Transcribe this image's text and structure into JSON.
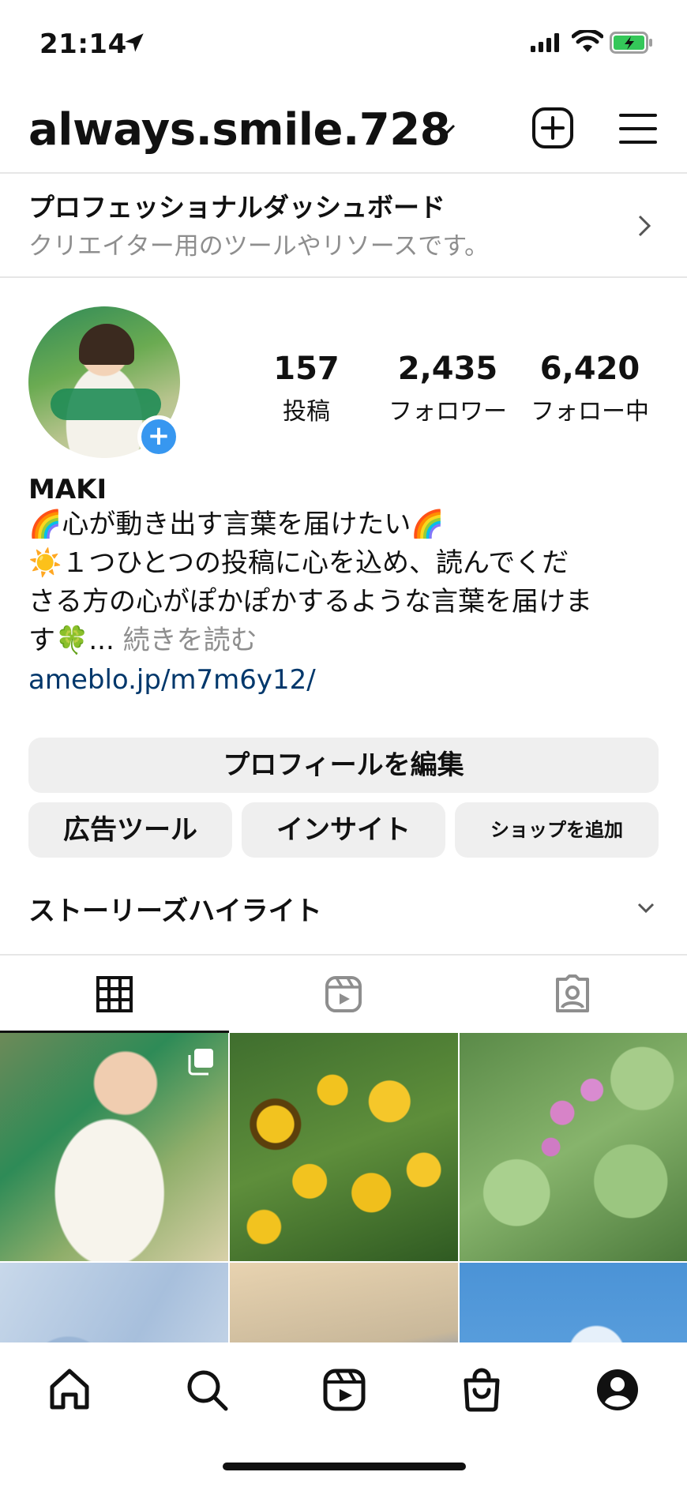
{
  "status_bar": {
    "time": "21:14"
  },
  "header": {
    "username": "always.smile.728"
  },
  "dashboard": {
    "title": "プロフェッショナルダッシュボード",
    "subtitle": "クリエイター用のツールやリソースです。"
  },
  "stats": {
    "posts": {
      "count": "157",
      "label": "投稿"
    },
    "followers": {
      "count": "2,435",
      "label": "フォロワー"
    },
    "following": {
      "count": "6,420",
      "label": "フォロー中"
    }
  },
  "bio": {
    "name": "MAKI",
    "line1": "🌈心が動き出す言葉を届けたい🌈",
    "line2": "☀️１つひとつの投稿に心を込め、読んでくだ",
    "line3": "さる方の心がぽかぽかするような言葉を届けま",
    "line4": "す🍀...",
    "more": "続きを読む",
    "link": "ameblo.jp/m7m6y12/"
  },
  "buttons": {
    "edit_profile": "プロフィールを編集",
    "ad_tools": "広告ツール",
    "insights": "インサイト",
    "add_shop": "ショップを追加"
  },
  "highlights": {
    "title": "ストーリーズハイライト"
  },
  "tabs": [
    {
      "icon": "grid-icon",
      "active": true
    },
    {
      "icon": "reels-icon",
      "active": false
    },
    {
      "icon": "tagged-icon",
      "active": false
    }
  ],
  "bottom_nav": [
    "home-icon",
    "search-icon",
    "reels-icon",
    "shop-icon",
    "profile-icon"
  ],
  "colors": {
    "accent": "#3797f0",
    "link": "#00376b",
    "muted": "#8e8e8e",
    "button_bg": "#efefef"
  }
}
